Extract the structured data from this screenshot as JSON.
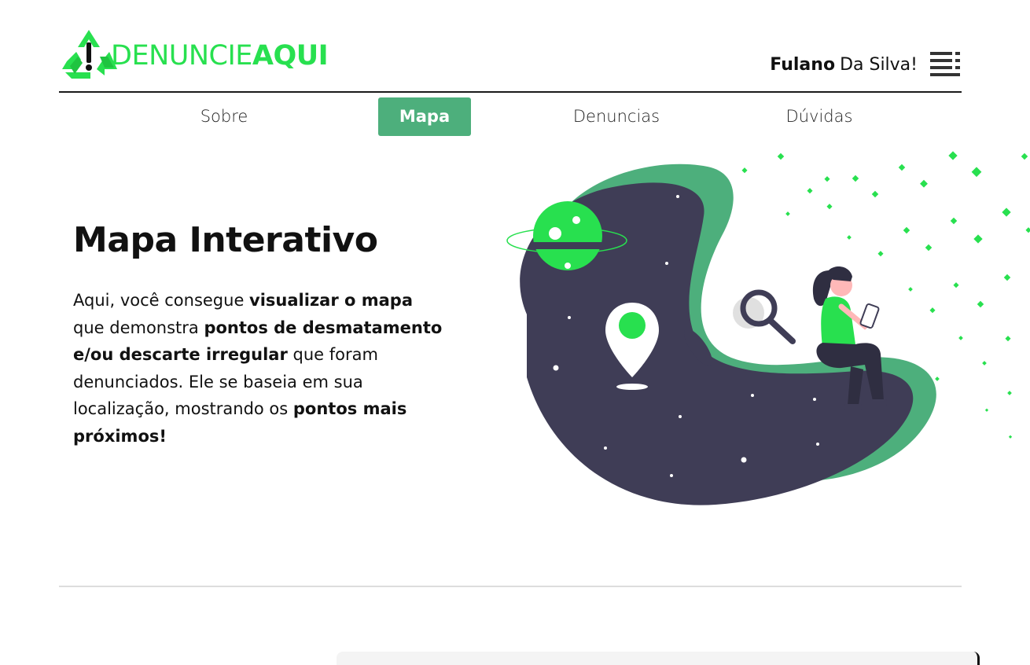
{
  "brand": {
    "name_part1": "DENUNCIE",
    "name_part2": "AQUI",
    "accent_color": "#28e04f",
    "logo_icon": "recycle-warning-icon"
  },
  "user": {
    "first_name": "Fulano",
    "last_name": "Da Silva!",
    "menu_icon": "menu-icon"
  },
  "nav": {
    "items": [
      {
        "label": "Sobre",
        "active": false
      },
      {
        "label": "Mapa",
        "active": true
      },
      {
        "label": "Denuncias",
        "active": false
      },
      {
        "label": "Dúvidas",
        "active": false
      }
    ],
    "active_color": "#4daf7c"
  },
  "hero": {
    "title": "Mapa Interativo",
    "text": {
      "p1": "Aqui, você consegue ",
      "b1": "visualizar o mapa",
      "p2": " que demonstra ",
      "b2": "pontos de desmatamento e/ou descarte irregular",
      "p3": " que foram denunciados. Ele se baseia em sua localização, mostrando os ",
      "b3": "pontos mais próximos!"
    },
    "illustration": "woman-sitting-on-map-blob-illustration"
  },
  "colors": {
    "blob_dark": "#3f3d56",
    "blob_green": "#4daf7c",
    "bright_green": "#28e04f"
  }
}
